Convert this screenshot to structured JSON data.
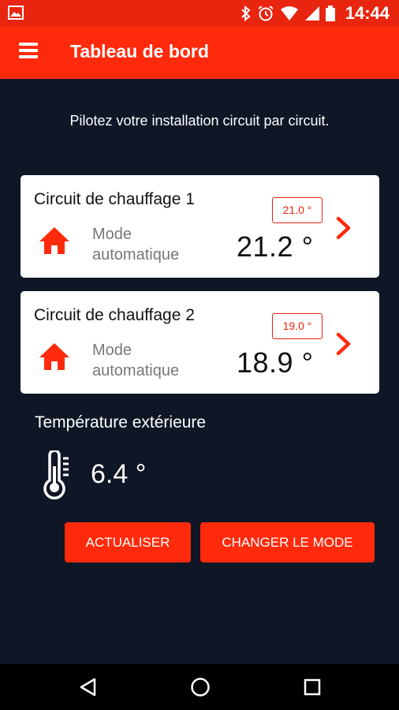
{
  "status_bar": {
    "time": "14:44"
  },
  "app_bar": {
    "title": "Tableau de bord"
  },
  "intro_text": "Pilotez votre installation circuit par circuit.",
  "circuits": [
    {
      "title": "Circuit de chauffage 1",
      "mode_line1": "Mode",
      "mode_line2": "automatique",
      "setpoint": "21.0 °",
      "temperature": "21.2 °"
    },
    {
      "title": "Circuit de chauffage 2",
      "mode_line1": "Mode",
      "mode_line2": "automatique",
      "setpoint": "19.0 °",
      "temperature": "18.9 °"
    }
  ],
  "outdoor": {
    "label": "Température extérieure",
    "temperature": "6.4 °"
  },
  "buttons": {
    "refresh_label": "ACTUALISER",
    "change_mode_label": "CHANGER LE MODE"
  },
  "colors": {
    "accent": "#ff2a0c",
    "background": "#0f1626",
    "card": "#ffffff",
    "text_muted": "#777777"
  },
  "icons": {
    "menu": "hamburger-menu-icon",
    "home": "home-icon",
    "chevron": "chevron-right-icon",
    "thermometer": "thermometer-icon"
  }
}
